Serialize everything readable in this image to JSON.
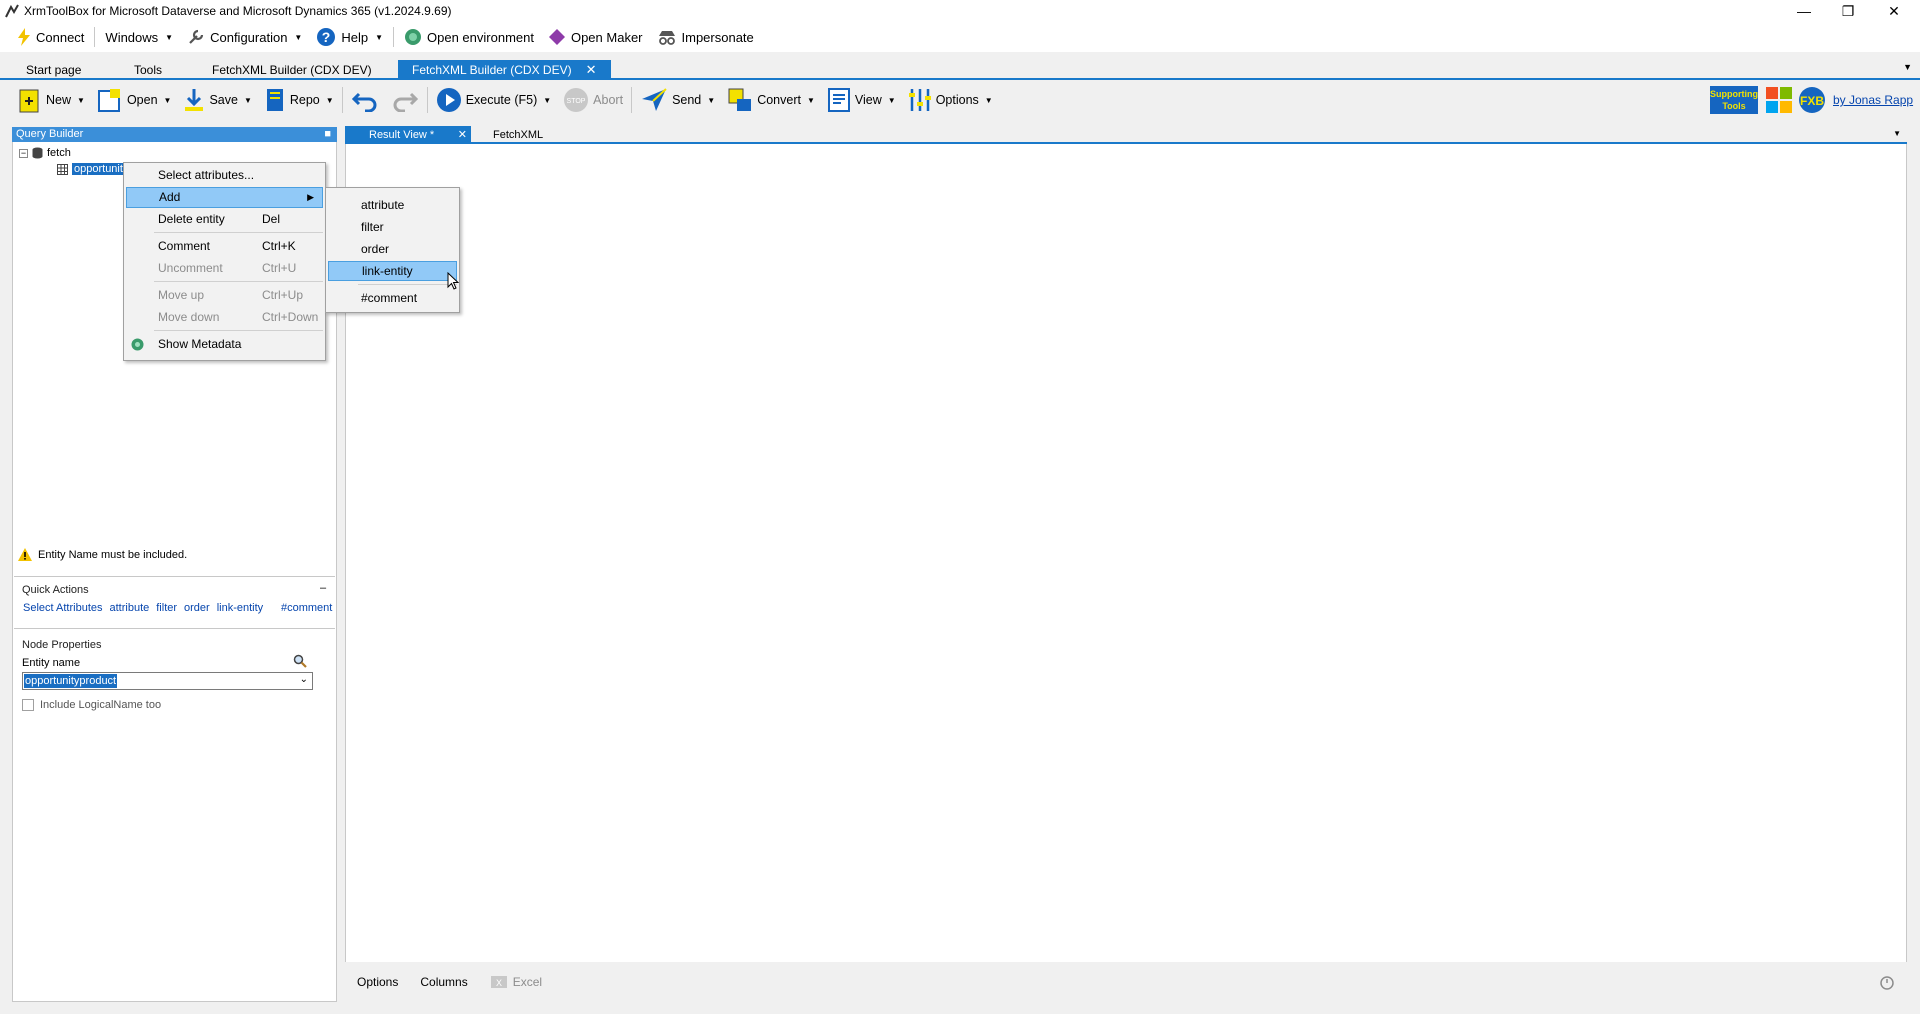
{
  "window": {
    "title": "XrmToolBox for Microsoft Dataverse and Microsoft Dynamics 365 (v1.2024.9.69)"
  },
  "menubar": {
    "items": [
      {
        "label": "Connect",
        "icon": "lightning-icon"
      },
      {
        "label": "Windows",
        "icon": ""
      },
      {
        "label": "Configuration",
        "icon": "wrench-icon"
      },
      {
        "label": "Help",
        "icon": "help-icon"
      },
      {
        "label": "Open environment",
        "icon": "globe-icon"
      },
      {
        "label": "Open Maker",
        "icon": "powerapps-icon"
      },
      {
        "label": "Impersonate",
        "icon": "incognito-icon"
      }
    ]
  },
  "tabs": [
    {
      "label": "Start page"
    },
    {
      "label": "Tools"
    },
    {
      "label": "FetchXML Builder (CDX DEV)"
    },
    {
      "label": "FetchXML Builder (CDX DEV)",
      "active": true
    }
  ],
  "toolbar": {
    "new": "New",
    "open": "Open",
    "save": "Save",
    "repo": "Repo",
    "execute": "Execute (F5)",
    "abort": "Abort",
    "send": "Send",
    "convert": "Convert",
    "view": "View",
    "options": "Options",
    "supporting": "Supporting Tools",
    "author": "by Jonas Rapp"
  },
  "query_builder": {
    "header": "Query Builder",
    "tree": {
      "root": "fetch",
      "child": "opportunit"
    },
    "warning": "Entity Name must be included.",
    "quick_actions": {
      "title": "Quick Actions",
      "collapse": "–",
      "links": [
        "Select Attributes",
        "attribute",
        "filter",
        "order",
        "link-entity",
        "#comment"
      ]
    },
    "node_properties": {
      "title": "Node Properties",
      "entity_label": "Entity name",
      "entity_value": "opportunityproduct",
      "include_logical": "Include LogicalName too"
    }
  },
  "context_menu": {
    "items": [
      {
        "label": "Select attributes...",
        "shortcut": ""
      },
      {
        "label": "Add",
        "shortcut": ""
      },
      {
        "label": "Delete entity",
        "shortcut": "Del"
      },
      {
        "label": "Comment",
        "shortcut": "Ctrl+K"
      },
      {
        "label": "Uncomment",
        "shortcut": "Ctrl+U"
      },
      {
        "label": "Move up",
        "shortcut": "Ctrl+Up"
      },
      {
        "label": "Move down",
        "shortcut": "Ctrl+Down"
      },
      {
        "label": "Show Metadata",
        "shortcut": ""
      }
    ]
  },
  "submenu": {
    "items": [
      "attribute",
      "filter",
      "order",
      "link-entity",
      "#comment"
    ]
  },
  "right": {
    "tabs": [
      "Result View *",
      "FetchXML"
    ],
    "bottom": [
      "Options",
      "Columns",
      "Excel"
    ]
  }
}
